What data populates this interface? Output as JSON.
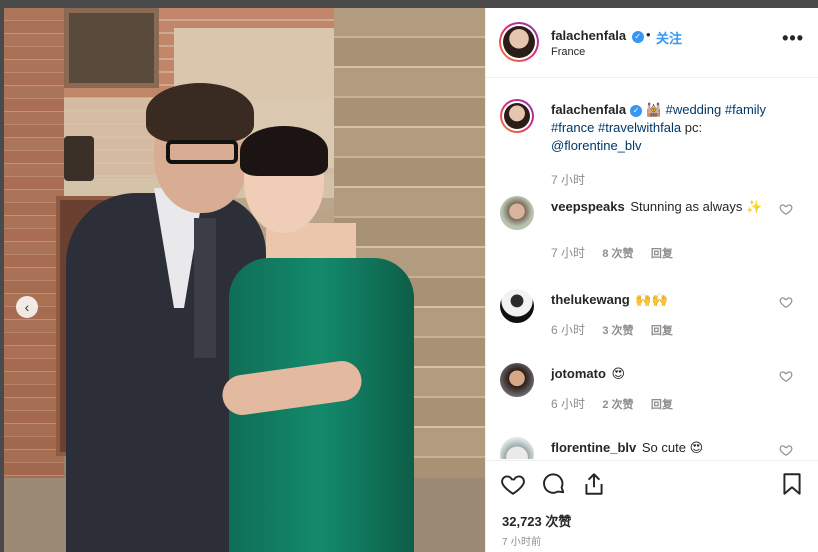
{
  "post": {
    "prev_glyph": "‹",
    "likes": "32,723 次赞",
    "time_ago": "7 小时前"
  },
  "header": {
    "username": "falachenfala",
    "verified_glyph": "✓",
    "dot": "•",
    "follow_label": "关注",
    "location": "France",
    "more_glyph": "•••"
  },
  "caption": {
    "username": "falachenfala",
    "verified_glyph": "✓",
    "emoji": "🕍",
    "tags": [
      "#wedding",
      "#family",
      "#france",
      "#travelwithfala"
    ],
    "credit_text": "pc:",
    "credit_mention": "@florentine_blv",
    "time": "7 小时"
  },
  "comments": [
    {
      "username": "veepspeaks",
      "text": "Stunning as always ✨",
      "time": "7 小时",
      "likes": "8 次赞",
      "reply": "回复"
    },
    {
      "username": "thelukewang",
      "text": "🙌🙌",
      "time": "6 小时",
      "likes": "3 次赞",
      "reply": "回复"
    },
    {
      "username": "jotomato",
      "text": "😍",
      "time": "6 小时",
      "likes": "2 次赞",
      "reply": "回复"
    },
    {
      "username": "florentine_blv",
      "text": "So cute 😍",
      "time": "",
      "likes": "",
      "reply": ""
    }
  ],
  "colors": {
    "link": "#3897f0",
    "hashtag": "#00376b",
    "muted": "#8e8e8e"
  },
  "icons": [
    "heart-icon",
    "comment-icon",
    "share-icon",
    "bookmark-icon",
    "more-options-icon",
    "verified-icon"
  ]
}
